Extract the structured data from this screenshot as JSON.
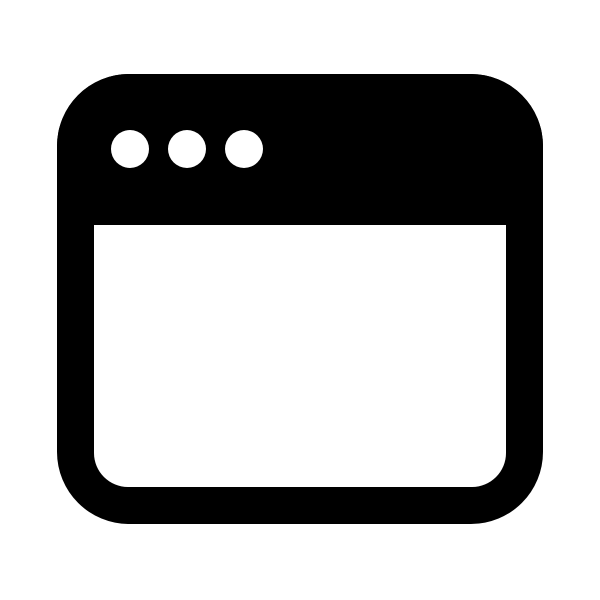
{
  "icon": {
    "name": "browser-window-icon",
    "ink_color": "#000000",
    "background_color": "#ffffff",
    "window_controls": [
      {
        "name": "window-control-dot"
      },
      {
        "name": "window-control-dot"
      },
      {
        "name": "window-control-dot"
      }
    ]
  }
}
